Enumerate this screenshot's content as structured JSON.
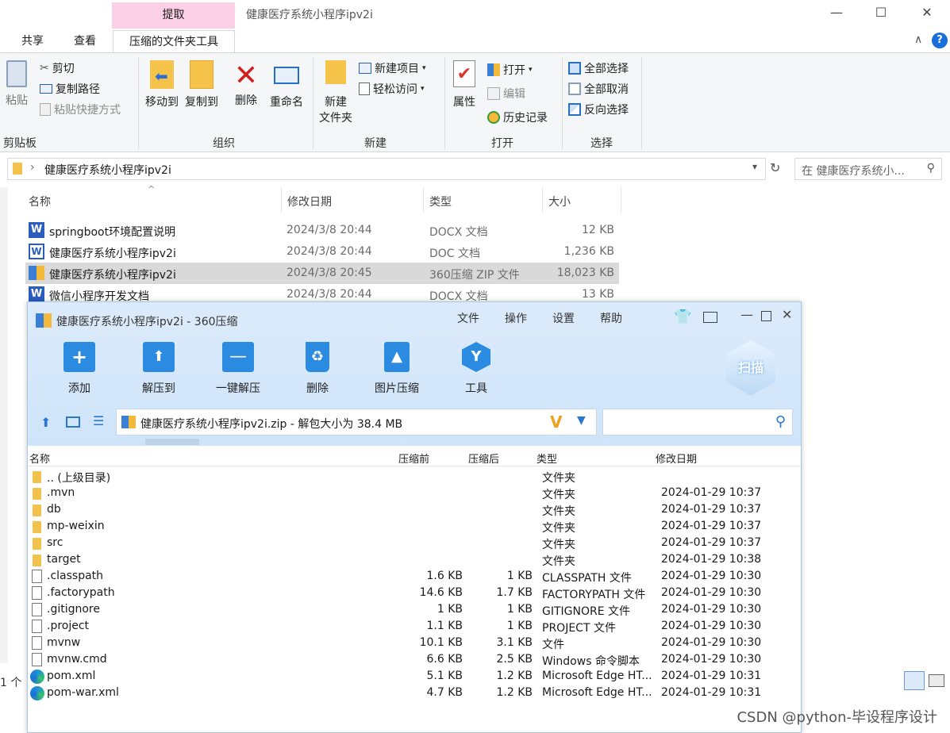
{
  "explorer": {
    "context_tab": "提取",
    "title": "健康医疗系统小程序ipv2i",
    "tabs": [
      "共享",
      "查看",
      "压缩的文件夹工具"
    ],
    "clipboard": {
      "paste": "粘贴",
      "cut": "剪切",
      "copy_path": "复制路径",
      "paste_shortcut": "粘贴快捷方式",
      "group": "剪贴板"
    },
    "organize": {
      "move_to": "移动到",
      "copy_to": "复制到",
      "delete": "删除",
      "rename": "重命名",
      "group": "组织"
    },
    "new": {
      "new_item": "新建项目",
      "easy_access": "轻松访问",
      "new_folder_l1": "新建",
      "new_folder_l2": "文件夹",
      "group": "新建"
    },
    "open": {
      "properties": "属性",
      "open": "打开",
      "edit": "编辑",
      "history": "历史记录",
      "group": "打开"
    },
    "select": {
      "select_all": "全部选择",
      "select_none": "全部取消",
      "invert": "反向选择",
      "group": "选择"
    },
    "address": "健康医疗系统小程序ipv2i",
    "search_placeholder": "在 健康医疗系统小...",
    "columns": {
      "name": "名称",
      "date": "修改日期",
      "type": "类型",
      "size": "大小"
    },
    "files": [
      {
        "name": "springboot环境配置说明",
        "date": "2024/3/8 20:44",
        "type": "DOCX 文档",
        "size": "12 KB",
        "icon": "word-icon"
      },
      {
        "name": "健康医疗系统小程序ipv2i",
        "date": "2024/3/8 20:44",
        "type": "DOC 文档",
        "size": "1,236 KB",
        "icon": "word-doc-icon"
      },
      {
        "name": "健康医疗系统小程序ipv2i",
        "date": "2024/3/8 20:45",
        "type": "360压缩 ZIP 文件",
        "size": "18,023 KB",
        "icon": "zip-icon"
      },
      {
        "name": "微信小程序开发文档",
        "date": "2024/3/8 20:44",
        "type": "DOCX 文档",
        "size": "13 KB",
        "icon": "word-icon"
      }
    ],
    "status_count": "1 个"
  },
  "zip": {
    "title": "健康医疗系统小程序ipv2i - 360压缩",
    "menu": [
      "文件",
      "操作",
      "设置",
      "帮助"
    ],
    "tools": [
      "添加",
      "解压到",
      "一键解压",
      "删除",
      "图片压缩",
      "工具"
    ],
    "scan_label": "扫描",
    "path": "健康医疗系统小程序ipv2i.zip - 解包大小为 38.4 MB",
    "columns": {
      "name": "名称",
      "before": "压缩前",
      "after": "压缩后",
      "type": "类型",
      "date": "修改日期"
    },
    "rows": [
      {
        "name": ".. (上级目录)",
        "before": "",
        "after": "",
        "type": "文件夹",
        "date": "",
        "icon": "folder"
      },
      {
        "name": ".mvn",
        "before": "",
        "after": "",
        "type": "文件夹",
        "date": "2024-01-29 10:37",
        "icon": "folder"
      },
      {
        "name": "db",
        "before": "",
        "after": "",
        "type": "文件夹",
        "date": "2024-01-29 10:37",
        "icon": "folder"
      },
      {
        "name": "mp-weixin",
        "before": "",
        "after": "",
        "type": "文件夹",
        "date": "2024-01-29 10:37",
        "icon": "folder"
      },
      {
        "name": "src",
        "before": "",
        "after": "",
        "type": "文件夹",
        "date": "2024-01-29 10:37",
        "icon": "folder"
      },
      {
        "name": "target",
        "before": "",
        "after": "",
        "type": "文件夹",
        "date": "2024-01-29 10:38",
        "icon": "folder"
      },
      {
        "name": ".classpath",
        "before": "1.6 KB",
        "after": "1 KB",
        "type": "CLASSPATH 文件",
        "date": "2024-01-29 10:30",
        "icon": "file"
      },
      {
        "name": ".factorypath",
        "before": "14.6 KB",
        "after": "1.7 KB",
        "type": "FACTORYPATH 文件",
        "date": "2024-01-29 10:30",
        "icon": "file"
      },
      {
        "name": ".gitignore",
        "before": "1 KB",
        "after": "1 KB",
        "type": "GITIGNORE 文件",
        "date": "2024-01-29 10:30",
        "icon": "file"
      },
      {
        "name": ".project",
        "before": "1.1 KB",
        "after": "1 KB",
        "type": "PROJECT 文件",
        "date": "2024-01-29 10:30",
        "icon": "file"
      },
      {
        "name": "mvnw",
        "before": "10.1 KB",
        "after": "3.1 KB",
        "type": "文件",
        "date": "2024-01-29 10:30",
        "icon": "file"
      },
      {
        "name": "mvnw.cmd",
        "before": "6.6 KB",
        "after": "2.5 KB",
        "type": "Windows 命令脚本",
        "date": "2024-01-29 10:30",
        "icon": "cmd"
      },
      {
        "name": "pom.xml",
        "before": "5.1 KB",
        "after": "1.2 KB",
        "type": "Microsoft Edge HT...",
        "date": "2024-01-29 10:31",
        "icon": "edge"
      },
      {
        "name": "pom-war.xml",
        "before": "4.7 KB",
        "after": "1.2 KB",
        "type": "Microsoft Edge HT...",
        "date": "2024-01-29 10:31",
        "icon": "edge"
      }
    ]
  },
  "watermark": "CSDN @python-毕设程序设计"
}
